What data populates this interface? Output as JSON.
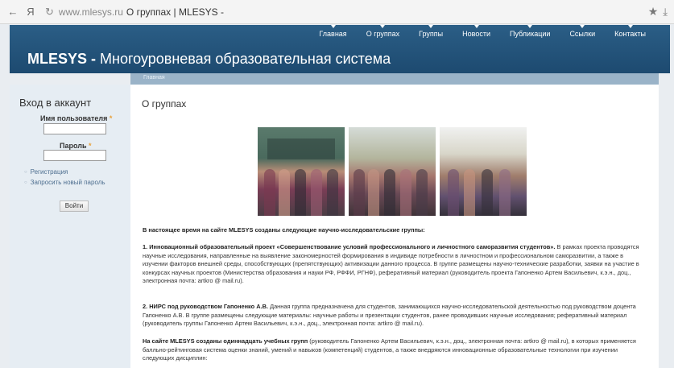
{
  "browser": {
    "back": "←",
    "yandex": "Я",
    "reload": "↻",
    "url": "www.mlesys.ru",
    "page_title": "О группах | MLESYS -",
    "star": "★",
    "download": "⤓"
  },
  "header": {
    "nav": [
      "Главная",
      "О группах",
      "Группы",
      "Новости",
      "Публикации",
      "Ссылки",
      "Контакты"
    ],
    "title_bold": "MLESYS -",
    "title_rest": " Многоуровневая образовательная система"
  },
  "breadcrumb": "Главная",
  "login": {
    "heading": "Вход в аккаунт",
    "username_label": "Имя пользователя",
    "password_label": "Пароль",
    "required_mark": "*",
    "register_link": "Регистрация",
    "reset_link": "Запросить новый пароль",
    "submit": "Войти"
  },
  "content": {
    "title": "О группах",
    "intro": "В настоящее время на сайте MLESYS созданы следующие научно-исследовательские группы:",
    "p1_bold": "1. Инновационный образовательный проект «Совершенствование условий профессионального и личностного саморазвития студентов».",
    "p1_rest": " В рамках проекта проводятся научные исследования, направленные на выявление закономерностей формирования в индивиде потребности в личностном и профессиональном саморазвитии, а также в изучении факторов внешней среды, способствующих (препятствующих) активизации данного процесса. В группе размещены научно-технические разработки, заявки на участие в конкурсах научных проектов (Министерства образования и науки РФ, РФФИ, РГНФ), реферативный материал (руководитель проекта Гапоненко Артем Васильевич, к.э.н., доц., электронная почта: artkro @ mail.ru).",
    "p2_bold": "2. НИРС под руководством Гапоненко А.В.",
    "p2_rest": " Данная группа предназначена для студентов, занимающихся научно-исследовательской деятельностью под руководством доцента Гапоненко А.В. В группе размещены следующие материалы: научные работы и презентации студентов, ранее проводивших научные исследования; реферативный материал (руководитель группы Гапоненко Артем Васильевич, к.э.н., доц., электронная почта: artkro @ mail.ru).",
    "p3_bold": "На сайте MLESYS созданы одиннадцать учебных групп",
    "p3_rest": " (руководитель Гапоненко Артем Васильевич, к.э.н., доц., электронная почта: artkro @ mail.ru), в которых применяется балльно-рейтинговая система оценки знаний, умений и навыков (компетенций) студентов, а также внедряются инновационные образовательные технологии при изучении следующих дисциплин:"
  }
}
